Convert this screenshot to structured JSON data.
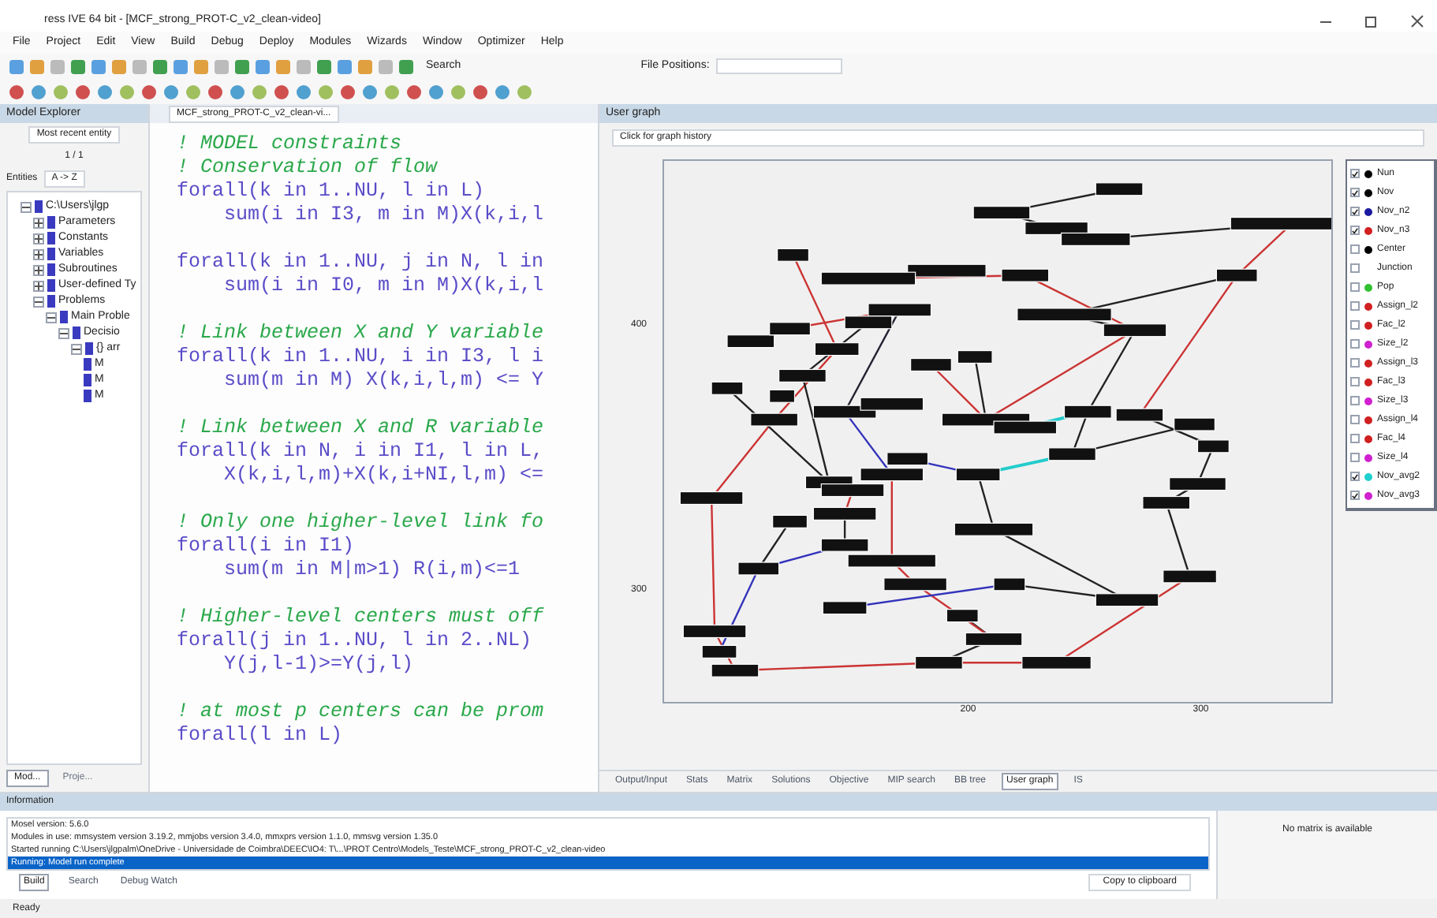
{
  "window": {
    "title": "ress IVE 64 bit - [MCF_strong_PROT-C_v2_clean-video]"
  },
  "menu": [
    "File",
    "Project",
    "Edit",
    "View",
    "Build",
    "Debug",
    "Deploy",
    "Modules",
    "Wizards",
    "Window",
    "Optimizer",
    "Help"
  ],
  "toolbar": {
    "search_label": "Search",
    "file_positions_label": "File Positions:"
  },
  "explorer": {
    "title": "Model Explorer",
    "dropdown": "Most recent entity",
    "counter": "1 / 1",
    "sort_label": "Entities",
    "sort_value": "A -> Z",
    "tree": [
      {
        "label": "C:\\Users\\jlgp",
        "expanded": true,
        "children": [
          {
            "label": "Parameters",
            "expanded": false
          },
          {
            "label": "Constants",
            "expanded": false
          },
          {
            "label": "Variables",
            "expanded": false
          },
          {
            "label": "Subroutines",
            "expanded": false
          },
          {
            "label": "User-defined Ty",
            "expanded": false
          },
          {
            "label": "Problems",
            "expanded": true,
            "children": [
              {
                "label": "Main Proble",
                "expanded": true,
                "children": [
                  {
                    "label": "Decisio",
                    "expanded": true,
                    "children": [
                      {
                        "label": "{} arr",
                        "expanded": true,
                        "children": [
                          {
                            "label": "M"
                          },
                          {
                            "label": "M"
                          },
                          {
                            "label": "M"
                          }
                        ]
                      }
                    ]
                  }
                ]
              }
            ]
          }
        ]
      }
    ],
    "tabs": [
      {
        "label": "Mod...",
        "selected": true
      },
      {
        "label": "Proje...",
        "selected": false
      }
    ]
  },
  "editor": {
    "tab": "MCF_strong_PROT-C_v2_clean-vi...",
    "lines": [
      {
        "kind": "comment",
        "text": "! MODEL constraints"
      },
      {
        "kind": "comment",
        "text": "! Conservation of flow"
      },
      {
        "kind": "code",
        "text": "forall(k in 1..NU, l in L)"
      },
      {
        "kind": "code",
        "text": "    sum(i in I3, m in M)X(k,i,l"
      },
      {
        "kind": "blank"
      },
      {
        "kind": "code",
        "text": "forall(k in 1..NU, j in N, l in"
      },
      {
        "kind": "code",
        "text": "    sum(i in I0, m in M)X(k,i,l"
      },
      {
        "kind": "blank"
      },
      {
        "kind": "comment",
        "text": "! Link between X and Y variable"
      },
      {
        "kind": "code",
        "text": "forall(k in 1..NU, i in I3, l i"
      },
      {
        "kind": "code",
        "text": "    sum(m in M) X(k,i,l,m) <= Y"
      },
      {
        "kind": "blank"
      },
      {
        "kind": "comment",
        "text": "! Link between X and R variable"
      },
      {
        "kind": "code",
        "text": "forall(k in N, i in I1, l in L,"
      },
      {
        "kind": "code",
        "text": "    X(k,i,l,m)+X(k,i+NI,l,m) <="
      },
      {
        "kind": "blank"
      },
      {
        "kind": "comment",
        "text": "! Only one higher-level link fo"
      },
      {
        "kind": "code",
        "text": "forall(i in I1)"
      },
      {
        "kind": "code",
        "text": "    sum(m in M|m>1) R(i,m)<=1"
      },
      {
        "kind": "blank"
      },
      {
        "kind": "comment",
        "text": "! Higher-level centers must off"
      },
      {
        "kind": "code",
        "text": "forall(j in 1..NU, l in 2..NL)"
      },
      {
        "kind": "code",
        "text": "    Y(j,l-1)>=Y(j,l)"
      },
      {
        "kind": "blank"
      },
      {
        "kind": "comment",
        "text": "! at most p centers can be prom"
      },
      {
        "kind": "code",
        "text": "forall(l in L)"
      }
    ]
  },
  "graph_panel": {
    "title": "User graph",
    "history": "Click for graph history",
    "y_ticks": [
      "400",
      "300"
    ],
    "x_ticks": [
      "200",
      "300"
    ],
    "legend": [
      {
        "label": "Nun",
        "checked": true,
        "color": "#000000"
      },
      {
        "label": "Nov",
        "checked": true,
        "color": "#000000"
      },
      {
        "label": "Nov_n2",
        "checked": true,
        "color": "#1a1aa0"
      },
      {
        "label": "Nov_n3",
        "checked": true,
        "color": "#d02020"
      },
      {
        "label": "Center",
        "checked": false,
        "color": "#000000"
      },
      {
        "label": "Junction",
        "checked": false
      },
      {
        "label": "Pop",
        "checked": false,
        "color": "#30c030"
      },
      {
        "label": "Assign_l2",
        "checked": false,
        "color": "#d02020"
      },
      {
        "label": "Fac_l2",
        "checked": false,
        "color": "#d02020"
      },
      {
        "label": "Size_l2",
        "checked": false,
        "color": "#d020d0"
      },
      {
        "label": "Assign_l3",
        "checked": false,
        "color": "#d02020"
      },
      {
        "label": "Fac_l3",
        "checked": false,
        "color": "#d02020"
      },
      {
        "label": "Size_l3",
        "checked": false,
        "color": "#d020d0"
      },
      {
        "label": "Assign_l4",
        "checked": false,
        "color": "#d02020"
      },
      {
        "label": "Fac_l4",
        "checked": false,
        "color": "#d02020"
      },
      {
        "label": "Size_l4",
        "checked": false,
        "color": "#d020d0"
      },
      {
        "label": "Nov_avg2",
        "checked": true,
        "color": "#20d0d0"
      },
      {
        "label": "Nov_avg3",
        "checked": true,
        "color": "#d020d0"
      }
    ],
    "tabs": [
      {
        "label": "Output/Input",
        "selected": false
      },
      {
        "label": "Stats",
        "selected": false
      },
      {
        "label": "Matrix",
        "selected": false
      },
      {
        "label": "Solutions",
        "selected": false
      },
      {
        "label": "Objective",
        "selected": false
      },
      {
        "label": "MIP search",
        "selected": false
      },
      {
        "label": "BB tree",
        "selected": false
      },
      {
        "label": "User graph",
        "selected": true
      },
      {
        "label": "IS",
        "selected": false
      }
    ]
  },
  "info": {
    "title": "Information",
    "lines": [
      {
        "text": "Mosel version: 5.6.0",
        "selected": false
      },
      {
        "text": "Modules in use: mmsystem version 3.19.2, mmjobs version 3.4.0, mmxprs version 1.1.0, mmsvg version 1.35.0",
        "selected": false
      },
      {
        "text": "Started running C:\\Users\\jlgpalm\\OneDrive - Universidade de Coimbra\\DEEC\\IO4: T\\...\\PROT Centro\\Models_Teste\\MCF_strong_PROT-C_v2_clean-video",
        "selected": false
      },
      {
        "text": "Running: Model run complete",
        "selected": true
      }
    ],
    "matrix_note": "No matrix is available",
    "copy_button": "Copy to clipboard",
    "tabs": [
      {
        "label": "Build",
        "selected": true
      },
      {
        "label": "Search",
        "selected": false
      },
      {
        "label": "Debug Watch",
        "selected": false
      }
    ]
  },
  "status_bar": {
    "text": "Ready"
  }
}
